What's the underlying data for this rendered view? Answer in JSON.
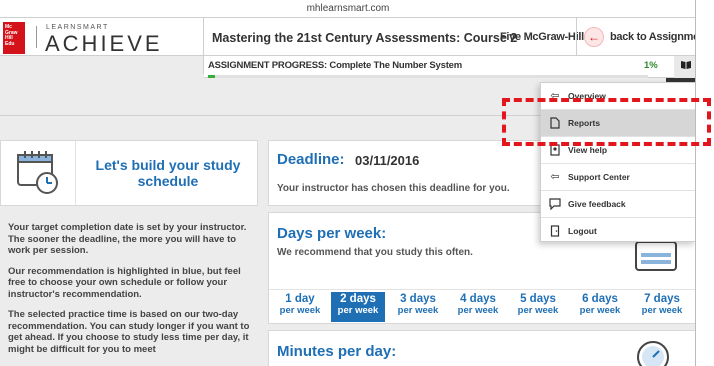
{
  "browser": {
    "url": "mhlearnsmart.com"
  },
  "brand": {
    "logo_text": "Mc Graw Hill Education",
    "small": "LEARNSMART",
    "big": "ACHIEVE",
    "colors": {
      "red": "#d4121a",
      "blue": "#1f6fb5",
      "green": "#3aab3e"
    }
  },
  "header": {
    "course_title": "Mastering the 21st Century Assessments: Course 2",
    "account": "Five McGraw-Hill",
    "back_label": "back to Assignments",
    "back_icon": "arrow-left-icon"
  },
  "progress": {
    "label": "ASSIGNMENT PROGRESS: Complete The Number System",
    "percent_text": "1%",
    "percent_value": 1
  },
  "build": {
    "title": "Let's build your study schedule"
  },
  "left_text": {
    "p1": "Your target completion date is set by your instructor. The sooner the deadline, the more you will have to work per session.",
    "p2": "Our recommendation is highlighted in blue, but feel free to choose your own schedule or follow your instructor's recommendation.",
    "p3": "The selected practice time is based on our two-day recommendation. You can study longer if you want to get ahead. If you choose to study less time per day, it might be difficult for you to meet"
  },
  "deadline": {
    "label": "Deadline:",
    "date": "03/11/2016",
    "note": "Your instructor has chosen this deadline for you."
  },
  "days": {
    "label": "Days per week:",
    "note": "We recommend that you study this often.",
    "options": [
      {
        "top": "1 day",
        "bottom": "per week",
        "selected": false
      },
      {
        "top": "2 days",
        "bottom": "per week",
        "selected": true
      },
      {
        "top": "3 days",
        "bottom": "per week",
        "selected": false
      },
      {
        "top": "4 days",
        "bottom": "per week",
        "selected": false
      },
      {
        "top": "5 days",
        "bottom": "per week",
        "selected": false
      },
      {
        "top": "6 days",
        "bottom": "per week",
        "selected": false
      },
      {
        "top": "7 days",
        "bottom": "per week",
        "selected": false
      }
    ]
  },
  "minutes": {
    "label": "Minutes per day:"
  },
  "menu": {
    "items": [
      {
        "label": "Overview",
        "icon": "arrow-left-outline-icon",
        "highlighted": false
      },
      {
        "label": "Reports",
        "icon": "document-icon",
        "highlighted": true
      },
      {
        "label": "View help",
        "icon": "help-icon",
        "highlighted": false
      },
      {
        "label": "Support Center",
        "icon": "arrow-left-outline-icon",
        "highlighted": false
      },
      {
        "label": "Give feedback",
        "icon": "chat-bubble-icon",
        "highlighted": false
      },
      {
        "label": "Logout",
        "icon": "door-icon",
        "highlighted": false
      }
    ]
  },
  "annotation": {
    "color": "#e3161d",
    "target": "Reports"
  }
}
